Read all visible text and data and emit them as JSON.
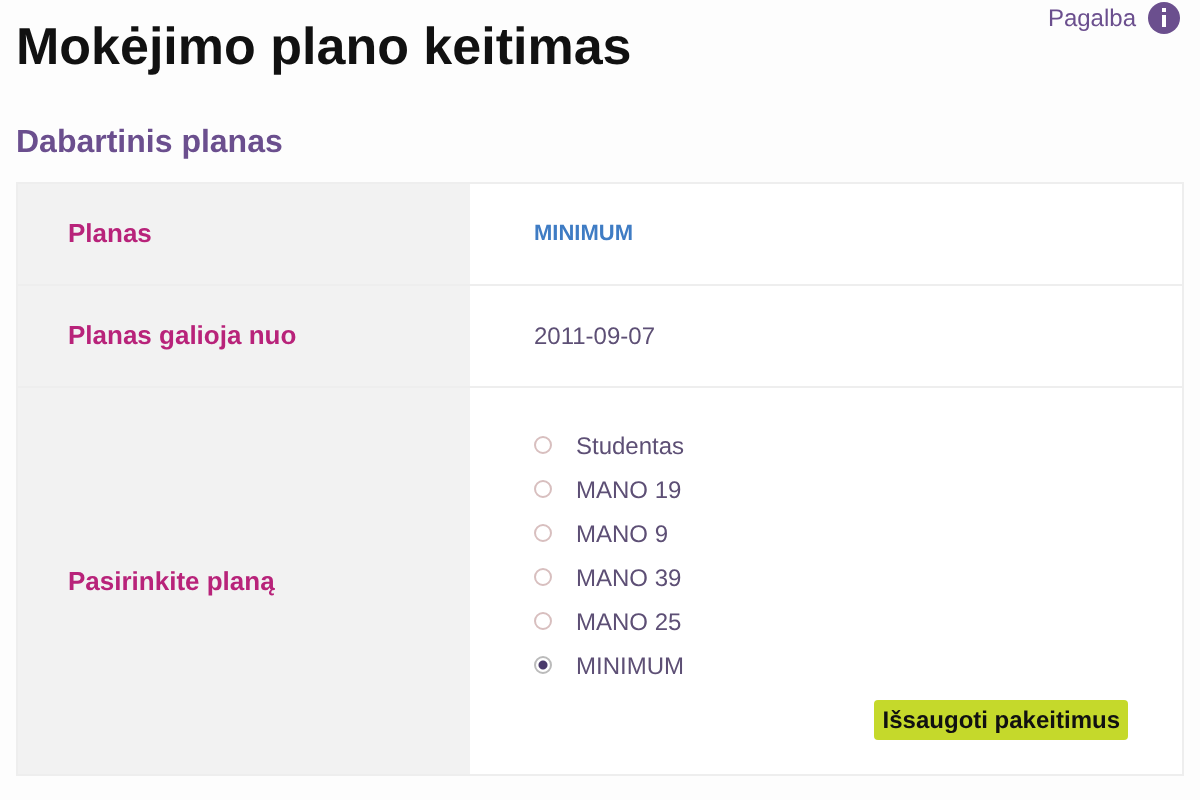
{
  "help_link": {
    "label": "Pagalba"
  },
  "page_title": "Mokėjimo plano keitimas",
  "section_title": "Dabartinis planas",
  "rows": [
    {
      "label": "Planas",
      "kind": "plan",
      "value": "MINIMUM"
    },
    {
      "label": "Planas galioja nuo",
      "kind": "text",
      "value": "2011-09-07"
    },
    {
      "label": "Pasirinkite planą",
      "kind": "radios",
      "options": [
        {
          "label": "Studentas",
          "selected": false
        },
        {
          "label": "MANO 19",
          "selected": false
        },
        {
          "label": "MANO 9",
          "selected": false
        },
        {
          "label": "MANO 39",
          "selected": false
        },
        {
          "label": "MANO 25",
          "selected": false
        },
        {
          "label": "MINIMUM",
          "selected": true
        }
      ]
    }
  ],
  "save_button": "Išsaugoti pakeitimus"
}
